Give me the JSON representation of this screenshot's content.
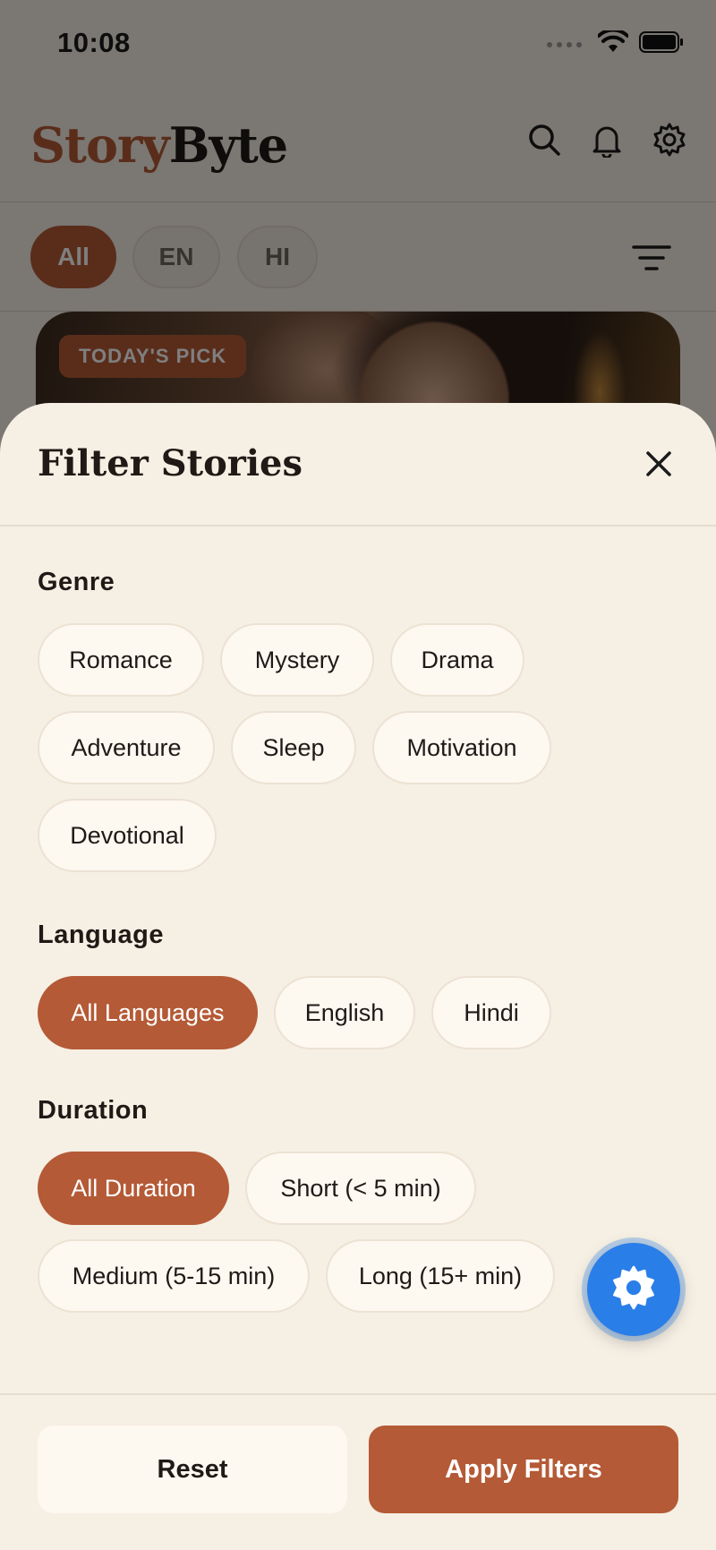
{
  "status_bar": {
    "time": "10:08"
  },
  "app": {
    "logo_part1": "Story",
    "logo_part2": "Byte",
    "lang_tabs": [
      {
        "label": "All",
        "active": true
      },
      {
        "label": "EN",
        "active": false
      },
      {
        "label": "HI",
        "active": false
      }
    ],
    "hero_badge": "TODAY'S PICK"
  },
  "sheet": {
    "title": "Filter Stories",
    "genre": {
      "label": "Genre",
      "options": [
        "Romance",
        "Mystery",
        "Drama",
        "Adventure",
        "Sleep",
        "Motivation",
        "Devotional"
      ]
    },
    "language": {
      "label": "Language",
      "options": [
        "All Languages",
        "English",
        "Hindi"
      ],
      "selected": "All Languages"
    },
    "duration": {
      "label": "Duration",
      "options": [
        "All Duration",
        "Short (< 5 min)",
        "Medium (5-15 min)",
        "Long (15+ min)"
      ],
      "selected": "All Duration"
    },
    "reset_label": "Reset",
    "apply_label": "Apply Filters"
  },
  "colors": {
    "accent": "#b45a36",
    "background": "#f6efe4",
    "fab": "#2a7ee8"
  },
  "icons": [
    "search-icon",
    "bell-icon",
    "gear-icon",
    "filter-lines-icon",
    "close-icon",
    "settings-fab-icon",
    "wifi-icon",
    "battery-icon"
  ]
}
